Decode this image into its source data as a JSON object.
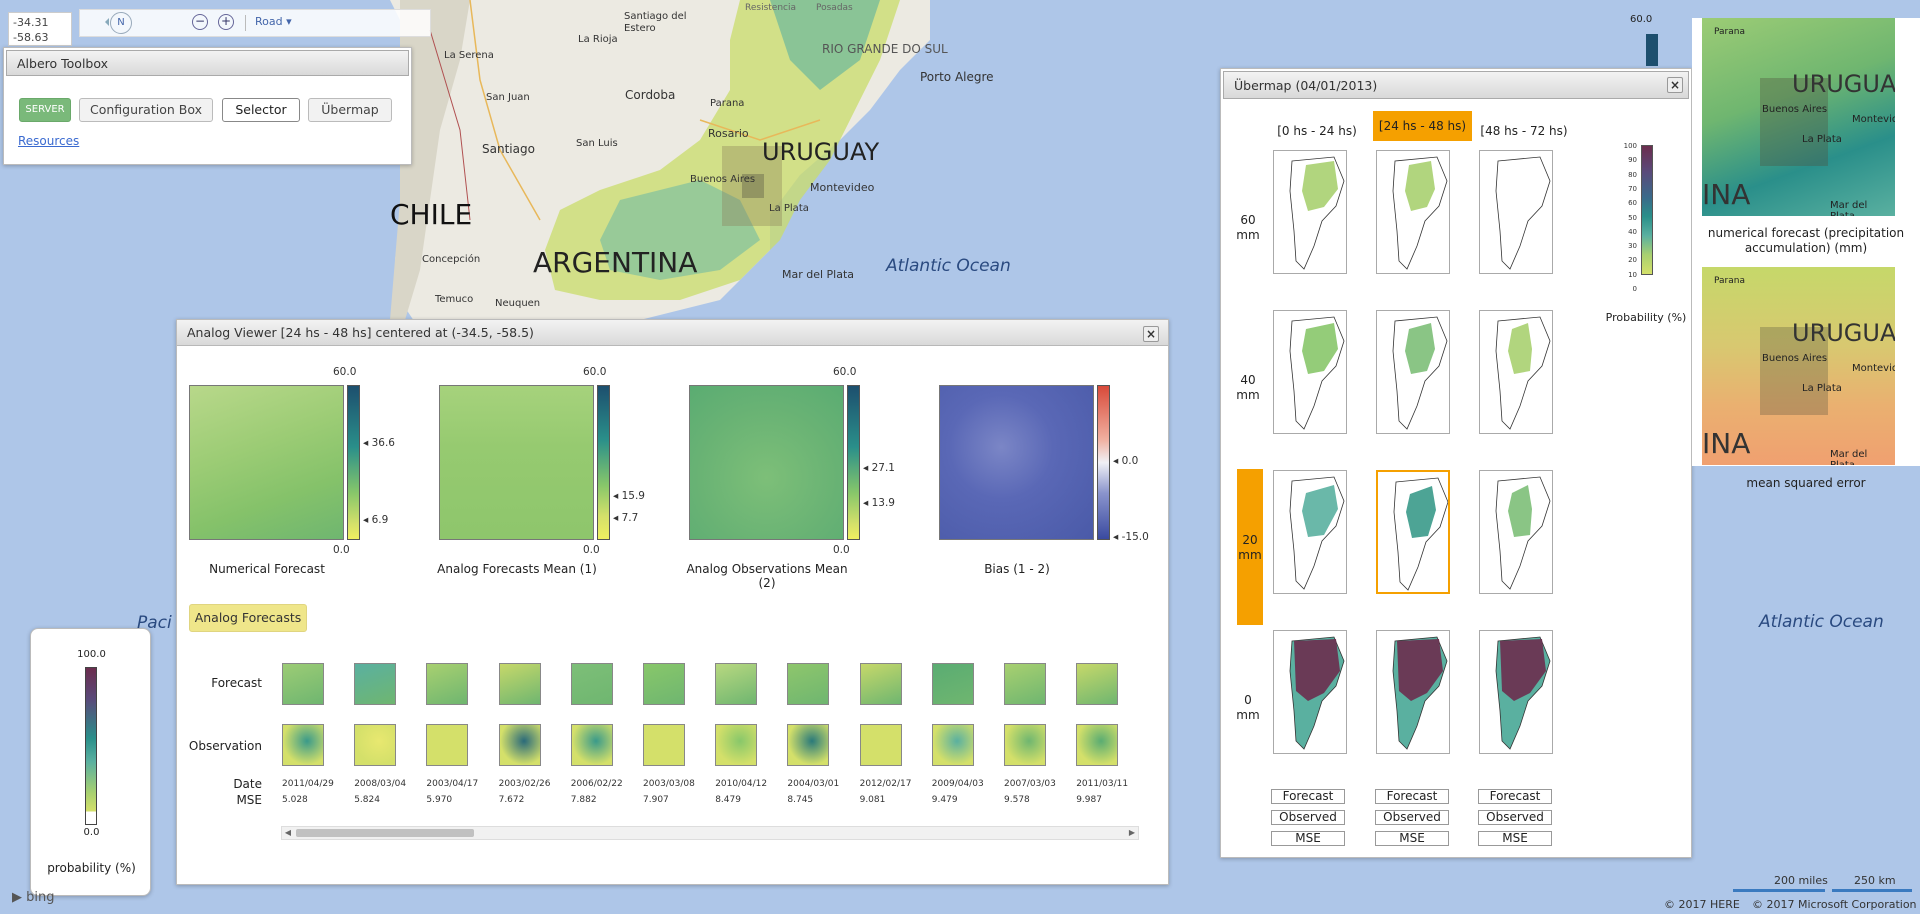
{
  "coords": {
    "lat": "-34.31",
    "lon": "-58.63"
  },
  "nav": {
    "north": "N",
    "map_type": "Road"
  },
  "toolbox": {
    "title": "Albero Toolbox",
    "server": "SERVER",
    "config": "Configuration Box",
    "selector": "Selector",
    "ubermap": "Übermap",
    "resources": "Resources"
  },
  "map_labels": {
    "chile": "CHILE",
    "argentina": "ARGENTINA",
    "uruguay": "URUGUAY",
    "atlantic": "Atlantic Ocean",
    "atlantic2": "Atlantic Ocean",
    "pacific": "Paci",
    "rio_grande": "RIO GRANDE DO SUL",
    "santiago_estero": "Santiago del Estero",
    "la_rioja": "La Rioja",
    "la_serena": "La Serena",
    "san_juan": "San Juan",
    "cordoba": "Cordoba",
    "santiago": "Santiago",
    "san_luis": "San Luis",
    "rosario": "Rosario",
    "parana": "Parana",
    "porto_alegre": "Porto Alegre",
    "buenos_aires": "Buenos Aires",
    "montevideo": "Montevideo",
    "la_plata": "La Plata",
    "concepcion": "Concepción",
    "temuco": "Temuco",
    "neuquen": "Neuquen",
    "mar_del_plata": "Mar del Plata",
    "resistencia": "Resistencia",
    "posadas": "Posadas"
  },
  "left_legend": {
    "max": "100.0",
    "min": "0.0",
    "label": "probability (%)"
  },
  "analog_viewer": {
    "title": "Analog Viewer [24 hs - 48 hs] centered at (-34.5, -58.5)",
    "panels": [
      {
        "name": "Numerical Forecast",
        "max": "60.0",
        "min": "0.0",
        "t1": "36.6",
        "t2": "6.9"
      },
      {
        "name": "Analog Forecasts Mean (1)",
        "max": "60.0",
        "min": "0.0",
        "t1": "15.9",
        "t2": "7.7"
      },
      {
        "name": "Analog Observations Mean (2)",
        "max": "60.0",
        "min": "0.0",
        "t1": "27.1",
        "t2": "13.9"
      },
      {
        "name": "Bias (1 - 2)",
        "t1": "0.0",
        "t2": "-15.0"
      }
    ],
    "analog_forecasts_btn": "Analog Forecasts",
    "row_forecast": "Forecast",
    "row_observation": "Observation",
    "row_date": "Date",
    "row_mse": "MSE",
    "analogs": [
      {
        "date": "2011/04/29",
        "mse": "5.028"
      },
      {
        "date": "2008/03/04",
        "mse": "5.824"
      },
      {
        "date": "2003/04/17",
        "mse": "5.970"
      },
      {
        "date": "2003/02/26",
        "mse": "7.672"
      },
      {
        "date": "2006/02/22",
        "mse": "7.882"
      },
      {
        "date": "2003/03/08",
        "mse": "7.907"
      },
      {
        "date": "2010/04/12",
        "mse": "8.479"
      },
      {
        "date": "2004/03/01",
        "mse": "8.745"
      },
      {
        "date": "2012/02/17",
        "mse": "9.081"
      },
      {
        "date": "2009/04/03",
        "mse": "9.479"
      },
      {
        "date": "2007/03/03",
        "mse": "9.578"
      },
      {
        "date": "2011/03/11",
        "mse": "9.987"
      }
    ]
  },
  "ubermap": {
    "title": "Übermap (04/01/2013)",
    "columns": [
      "[0 hs - 24 hs)",
      "[24 hs - 48 hs)",
      "[48 hs - 72 hs)"
    ],
    "rows": [
      {
        "value": "60",
        "unit": "mm"
      },
      {
        "value": "40",
        "unit": "mm"
      },
      {
        "value": "20",
        "unit": "mm"
      },
      {
        "value": "0",
        "unit": "mm"
      }
    ],
    "buttons": [
      "Forecast",
      "Observed",
      "MSE"
    ],
    "legend_ticks": [
      "100",
      "90",
      "80",
      "70",
      "60",
      "50",
      "40",
      "30",
      "20",
      "10",
      "0"
    ],
    "legend_label": "Probability (%)"
  },
  "right_legend": {
    "max": "60.0"
  },
  "side_maps": {
    "caption1": "numerical forecast (precipitation accumulation) (mm)",
    "caption2": "mean squared error",
    "uruguay": "URUGUA",
    "ina": "INA",
    "buenos_aires": "Buenos Aires",
    "montevideo": "Montevid",
    "la_plata": "La Plata",
    "mar_del_plata": "Mar del Plata",
    "parana": "Parana"
  },
  "footer": {
    "copyright1": "© 2017 HERE",
    "copyright2": "© 2017 Microsoft Corporation",
    "scale1": "200 miles",
    "scale2": "250 km",
    "bing": "bing"
  },
  "colors": {
    "accent_orange": "#f5a000",
    "server_green": "#7ab97a",
    "precip_light": "#d4e06a",
    "precip_mid": "#88c76a",
    "precip_dark": "#2a8f8a",
    "precip_deep": "#1d4f6e",
    "prob_high": "#6b2d4e",
    "bias_blue": "#4a5aa8"
  }
}
